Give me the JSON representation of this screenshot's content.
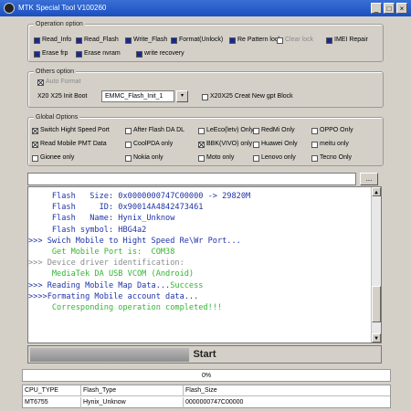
{
  "window": {
    "title": "MTK Special Tool V100260",
    "ctrl_min": "_",
    "ctrl_max": "□",
    "ctrl_close": "×"
  },
  "operation": {
    "title": "Operation option",
    "items": [
      {
        "label": "Read_Info",
        "checked": true
      },
      {
        "label": "Read_Flash",
        "checked": true
      },
      {
        "label": "Write_Flash",
        "checked": true
      },
      {
        "label": "Format(Unlock)",
        "checked": true
      },
      {
        "label": "Re Pattern lock",
        "checked": true
      },
      {
        "label": "Clear lock",
        "checked": false,
        "disabled": true
      },
      {
        "label": "IMEI Repair",
        "checked": true
      },
      {
        "label": "Erase frp",
        "checked": true
      },
      {
        "label": "Erase nvram",
        "checked": true
      },
      {
        "label": "write recovery",
        "checked": true
      }
    ]
  },
  "others": {
    "title": "Others option",
    "auto_format": "Auto Format",
    "boot_label": "X20 X25 Init Boot",
    "boot_value": "EMMC_Flash_Init_1",
    "gpt_label": "X20X25 Creat New gpt Block"
  },
  "global": {
    "title": "Global Options",
    "items": [
      {
        "label": "Switch Hight Speed Port",
        "checked": true
      },
      {
        "label": "After Flash DA DL",
        "checked": false
      },
      {
        "label": "LeEco(letv) Only",
        "checked": false
      },
      {
        "label": "RedMi Only",
        "checked": false
      },
      {
        "label": "OPPO Only",
        "checked": false
      },
      {
        "label": "Read Mobile PMT Data",
        "checked": true
      },
      {
        "label": "CoolPDA only",
        "checked": false
      },
      {
        "label": "BBK(VIVO) only",
        "checked": true
      },
      {
        "label": "Huawei Only",
        "checked": false
      },
      {
        "label": "meitu only",
        "checked": false
      },
      {
        "label": "Gionee only",
        "checked": false
      },
      {
        "label": "Nokia only",
        "checked": false
      },
      {
        "label": "Moto only",
        "checked": false
      },
      {
        "label": "Lenovo only",
        "checked": false
      },
      {
        "label": "Tecno Only",
        "checked": false
      }
    ]
  },
  "file": {
    "value": "",
    "browse": "..."
  },
  "log": [
    {
      "text": "     Flash   Size: 0x0000000747C00000 -> 29820M",
      "color": "#1f33a8"
    },
    {
      "text": "     Flash     ID: 0x90014A4842473461",
      "color": "#1f33a8"
    },
    {
      "text": "     Flash   Name: Hynix_Unknow",
      "color": "#1f33a8"
    },
    {
      "text": "     Flash symbol: HBG4a2",
      "color": "#1f33a8"
    },
    {
      "text": ">>> Swich Mobile to Hight Speed Re\\Wr Port...",
      "color": "#1f33a8"
    },
    {
      "text": "     Get Mobile Port is:  COM38",
      "color": "#33b533"
    },
    {
      "text": ">>> Device driver identification:",
      "color": "#8a8a8a"
    },
    {
      "text": "     MediaTek DA USB VCOM (Android)",
      "color": "#33b533"
    },
    {
      "text": ">>> Reading Mobile Map Data...",
      "color": "#1f33a8",
      "suffix": "Success",
      "suffix_color": "#33b533"
    },
    {
      "text": ">>>>Formating Mobile account data...",
      "color": "#1f33a8"
    },
    {
      "text": "     Corresponding operation completed!!!",
      "color": "#33b533"
    }
  ],
  "start": {
    "label": "Start",
    "progress_left_fraction": 0.45
  },
  "progress": {
    "percent": "0%"
  },
  "status": {
    "headers": [
      "CPU_TYPE",
      "Flash_Type",
      "Flash_Size"
    ],
    "values": [
      "MT6755",
      "Hynix_Unknow",
      "0000000747C00000"
    ]
  },
  "colors": {
    "accent": "#1a2a88",
    "log_blue": "#1f33a8",
    "log_green": "#33b533"
  }
}
